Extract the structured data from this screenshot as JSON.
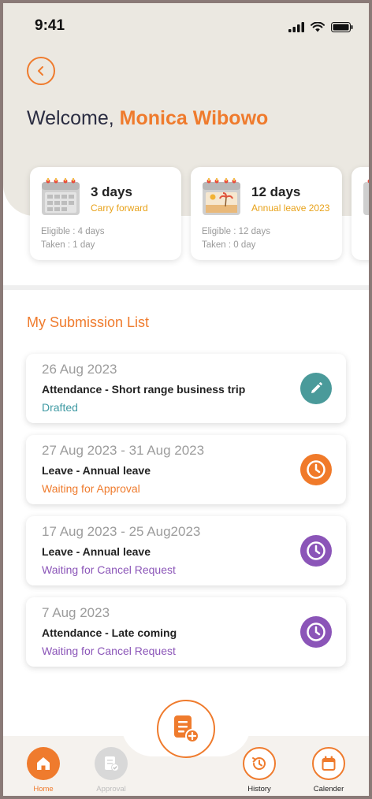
{
  "status_bar": {
    "time": "9:41"
  },
  "header": {
    "welcome_prefix": "Welcome, ",
    "user_name": "Monica Wibowo"
  },
  "leave_cards": [
    {
      "days": "3 days",
      "kind": "Carry forward",
      "eligible": "Eligible : 4 days",
      "taken": "Taken : 1 day"
    },
    {
      "days": "12 days",
      "kind": "Annual leave 2023",
      "eligible": "Eligible : 12 days",
      "taken": "Taken : 0 day"
    }
  ],
  "submission": {
    "section_title": "My Submission List",
    "items": [
      {
        "date": "26 Aug 2023",
        "title": "Attendance - Short range business trip",
        "status": "Drafted",
        "status_color": "#3f9aa3",
        "icon": "edit-icon",
        "icon_color": "#4a9a9a"
      },
      {
        "date": "27 Aug 2023 - 31 Aug 2023",
        "title": "Leave - Annual leave",
        "status": "Waiting for Approval",
        "status_color": "#ef7b2d",
        "icon": "clock-icon",
        "icon_color": "#f07a2a"
      },
      {
        "date": "17 Aug 2023 - 25 Aug2023",
        "title": "Leave - Annual leave",
        "status": "Waiting for Cancel Request",
        "status_color": "#8b55b8",
        "icon": "clock-icon",
        "icon_color": "#8b55b8"
      },
      {
        "date": "7 Aug 2023",
        "title": "Attendance - Late coming",
        "status": "Waiting for Cancel Request",
        "status_color": "#8b55b8",
        "icon": "clock-icon",
        "icon_color": "#8b55b8"
      }
    ]
  },
  "nav": {
    "home": "Home",
    "approval": "Approval",
    "history": "History",
    "calendar": "Calender"
  },
  "colors": {
    "accent": "#ef7b2d",
    "hero_bg": "#ebe8e1"
  }
}
